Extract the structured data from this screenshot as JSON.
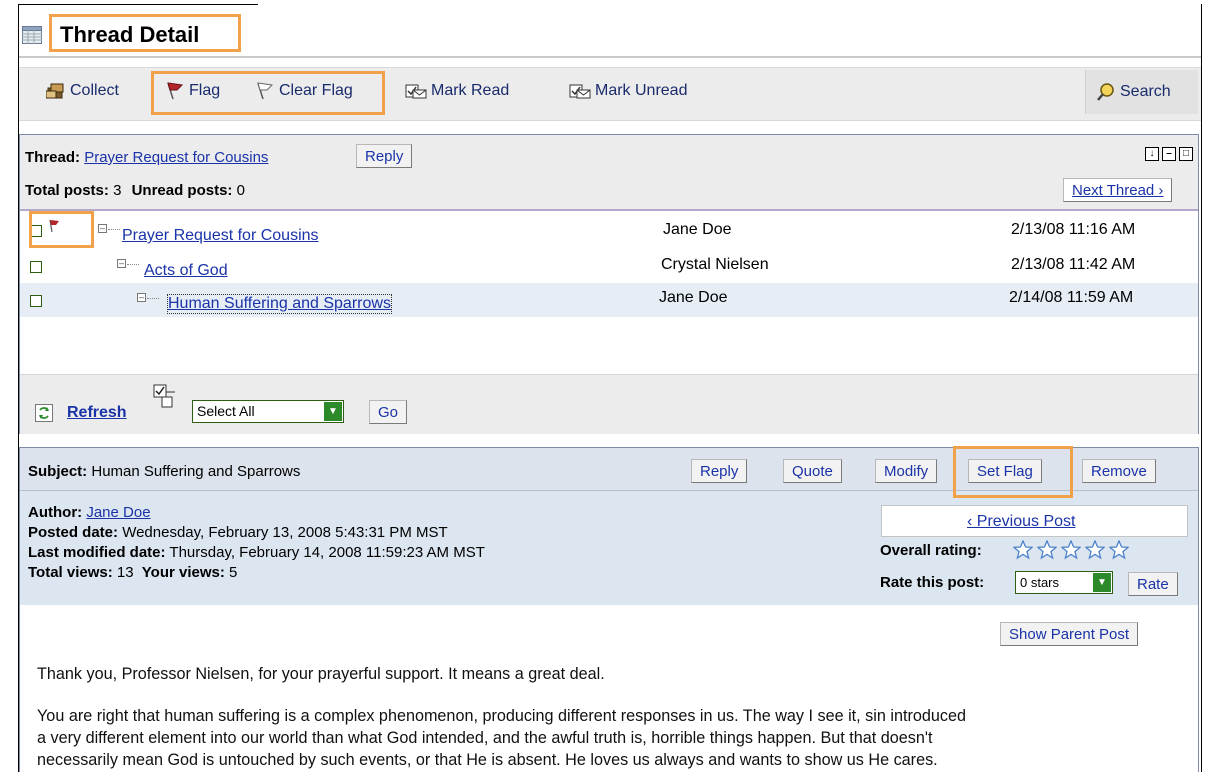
{
  "page": {
    "title": "Thread Detail"
  },
  "toolbar": {
    "collect": "Collect",
    "flag": "Flag",
    "clear_flag": "Clear Flag",
    "mark_read": "Mark Read",
    "mark_unread": "Mark Unread",
    "search": "Search"
  },
  "thread": {
    "label": "Thread:",
    "name": "Prayer Request for Cousins",
    "reply": "Reply",
    "total_posts_label": "Total posts:",
    "total_posts": "3",
    "unread_posts_label": "Unread posts:",
    "unread_posts": "0",
    "next_thread": "Next Thread ›",
    "posts": [
      {
        "title": "Prayer Request for Cousins",
        "author": "Jane Doe",
        "date": "2/13/08 11:16 AM",
        "flagged": true
      },
      {
        "title": "Acts of God",
        "author": "Crystal Nielsen",
        "date": "2/13/08 11:42 AM",
        "flagged": false
      },
      {
        "title": "Human Suffering and Sparrows",
        "author": "Jane Doe",
        "date": "2/14/08 11:59 AM",
        "flagged": false
      }
    ],
    "refresh": "Refresh",
    "select_value": "Select All",
    "go": "Go"
  },
  "post": {
    "subject_label": "Subject:",
    "subject": "Human Suffering and Sparrows",
    "buttons": {
      "reply": "Reply",
      "quote": "Quote",
      "modify": "Modify",
      "set_flag": "Set Flag",
      "remove": "Remove"
    },
    "author_label": "Author:",
    "author": "Jane Doe",
    "posted_label": "Posted date:",
    "posted": "Wednesday, February 13, 2008 5:43:31 PM MST",
    "modified_label": "Last modified date:",
    "modified": "Thursday, February 14, 2008 11:59:23 AM MST",
    "views_label": "Total views:",
    "views": "13",
    "your_views_label": "Your views:",
    "your_views": "5",
    "previous_post": "‹ Previous Post",
    "overall_rating_label": "Overall rating:",
    "rate_label": "Rate this post:",
    "rate_value": "0 stars",
    "rate_button": "Rate",
    "show_parent": "Show Parent Post",
    "body_p1": "Thank you, Professor Nielsen, for your prayerful support. It means a great deal.",
    "body_p2_l1": "You are right that human suffering is a complex phenomenon, producing different responses in us. The way I see it, sin introduced",
    "body_p2_l2": "a very different element into our world than what God intended, and the awful truth is, horrible things happen. But that doesn't",
    "body_p2_l3": "necessarily mean God is untouched by such events, or that He is absent. He loves us always and wants to show us He cares."
  },
  "colors": {
    "highlight": "#f0a14a",
    "link": "#1a33a8",
    "flag": "#b3262b"
  }
}
